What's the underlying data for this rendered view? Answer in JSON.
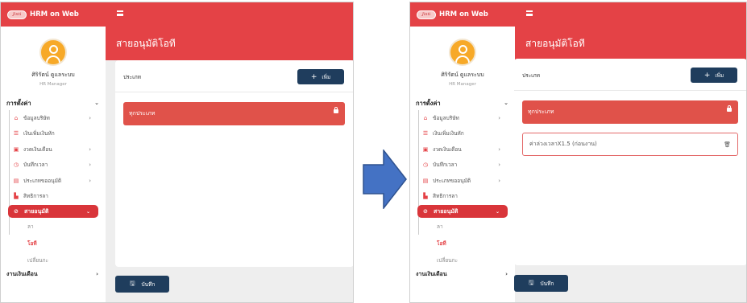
{
  "brand": {
    "logo_text": "Jinti",
    "name": "HRM on Web"
  },
  "page_title": "สายอนุมัติโอที",
  "user": {
    "name": "ศิริรัตน์ ดูแลระบบ",
    "role": "HR Manager"
  },
  "menu": {
    "settings_label": "การตั้งค่า",
    "items": [
      {
        "label": "ข้อมูลบริษัท",
        "icon": "home-icon"
      },
      {
        "label": "เงินเพิ่มเงินหัก",
        "icon": "list-icon"
      },
      {
        "label": "งวดเงินเดือน",
        "icon": "money-icon"
      },
      {
        "label": "บันทึกเวลา",
        "icon": "clock-icon"
      },
      {
        "label": "ประเภทขออนุมัติ",
        "icon": "calendar-icon"
      },
      {
        "label": "สิทธิการลา",
        "icon": "document-icon"
      }
    ],
    "active": {
      "label": "สายอนุมัติ",
      "icon": "check-circle-icon"
    },
    "subitems": [
      "ลา",
      "โอที",
      "เปลี่ยนกะ"
    ],
    "selected_subitem": "โอที",
    "payroll_label": "งานเงินเดือน"
  },
  "card": {
    "label": "ประเภท",
    "add_label": "เพิ่ม",
    "rows_left": [
      {
        "label": "ทุกประเภท",
        "locked": true
      }
    ],
    "rows_right": [
      {
        "label": "ทุกประเภท",
        "locked": true
      },
      {
        "label": "ค่าล่วงเวลาX1.5 (ก่อนงาน)",
        "locked": false
      }
    ]
  },
  "save_label": "บันทึก",
  "colors": {
    "primary_red": "#e44246",
    "navy": "#1f3d5d",
    "arrow_blue": "#4472c4"
  }
}
